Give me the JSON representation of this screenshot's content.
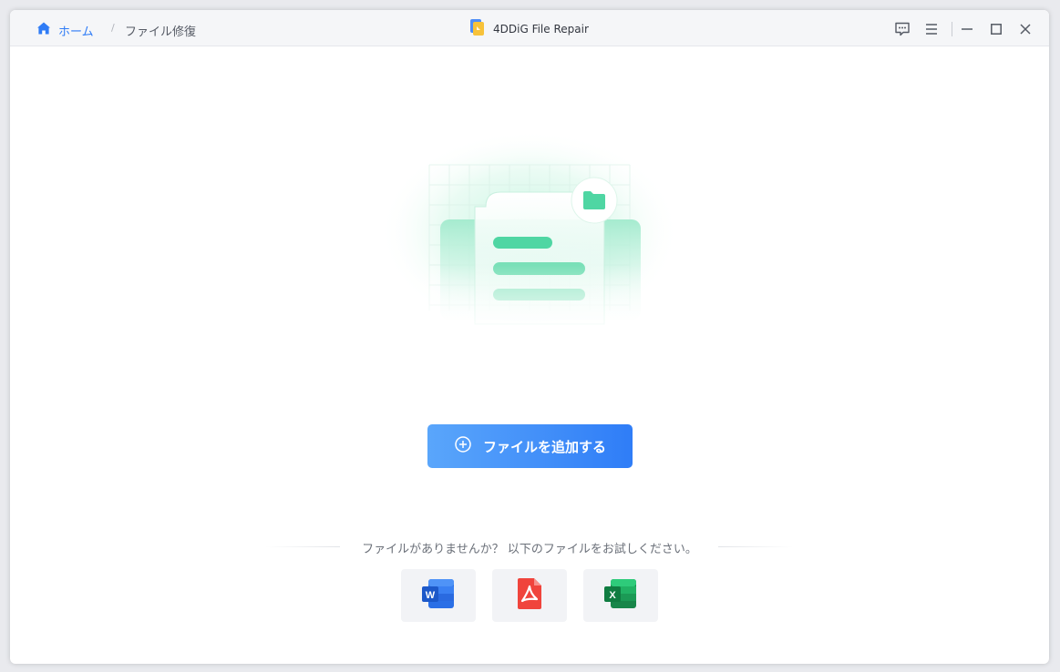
{
  "breadcrumb": {
    "home_label": "ホーム",
    "separator": "/",
    "current": "ファイル修復"
  },
  "app": {
    "title": "4DDiG File Repair"
  },
  "window_controls": {
    "icons": [
      "feedback-icon",
      "menu-icon",
      "minimize-icon",
      "maximize-icon",
      "close-icon"
    ]
  },
  "main": {
    "add_button_label": "ファイルを追加する",
    "hint": "ファイルがありませんか？ 以下のファイルをお試しください。",
    "samples": [
      {
        "icon": "word-icon",
        "letter": "W",
        "color": "#2b6fe6"
      },
      {
        "icon": "pdf-icon",
        "color": "#f0443c"
      },
      {
        "icon": "excel-icon",
        "letter": "X",
        "color": "#1ea45a"
      }
    ]
  },
  "colors": {
    "accent": "#2f7df7",
    "illustration": "#4fd6a3"
  }
}
